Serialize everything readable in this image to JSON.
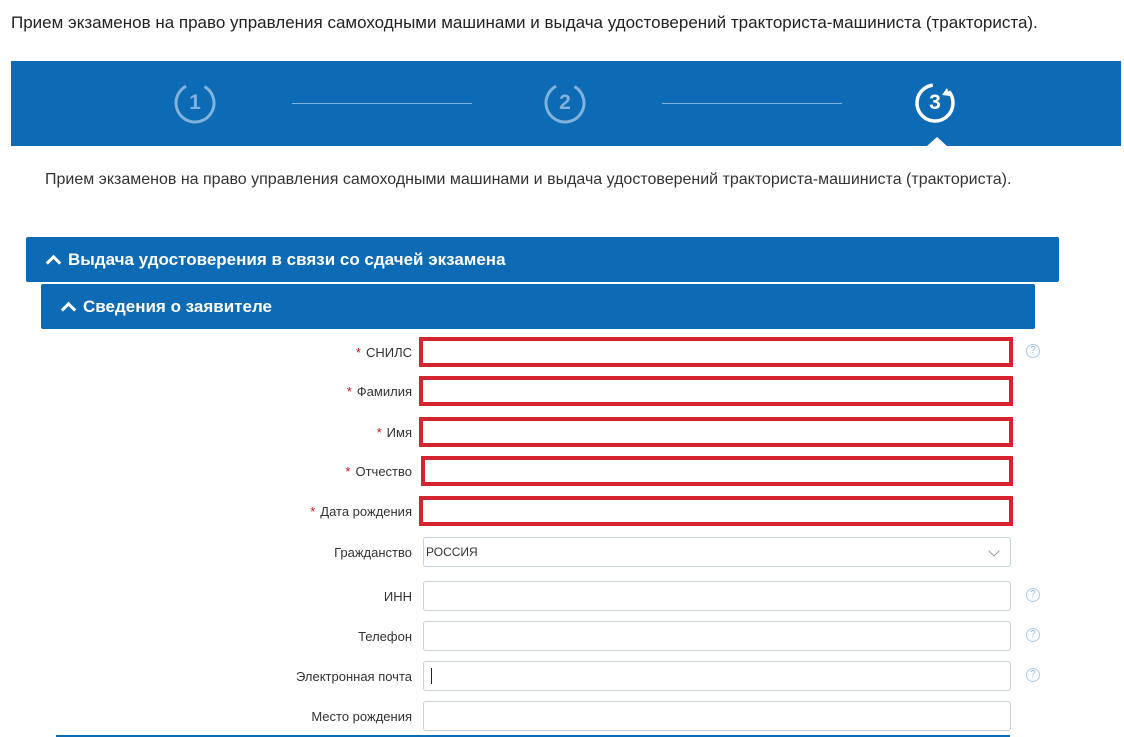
{
  "page": {
    "title": "Прием экзаменов на право управления самоходными машинами и выдача удостоверений тракториста-машиниста (тракториста)."
  },
  "stepper": {
    "steps": [
      {
        "number": "1",
        "state": "done"
      },
      {
        "number": "2",
        "state": "done"
      },
      {
        "number": "3",
        "state": "active"
      }
    ],
    "accent": "#0d6ab4"
  },
  "service": {
    "description": "Прием экзаменов на право управления самоходными машинами и выдача удостоверений тракториста-машиниста (тракториста)."
  },
  "sections": {
    "outer_label": "Выдача удостоверения в связи со сдачей экзамена",
    "inner_label": "Сведения о заявителе"
  },
  "form": {
    "required_mark": "*",
    "help_symbol": "?",
    "fields": {
      "snils": {
        "label": "СНИЛС",
        "value": ""
      },
      "surname": {
        "label": "Фамилия",
        "value": ""
      },
      "name": {
        "label": "Имя",
        "value": ""
      },
      "patronymic": {
        "label": "Отчество",
        "value": ""
      },
      "birth_date": {
        "label": "Дата рождения",
        "value": ""
      },
      "citizenship": {
        "label": "Гражданство",
        "value": "РОССИЯ"
      },
      "inn": {
        "label": "ИНН",
        "value": ""
      },
      "phone": {
        "label": "Телефон",
        "value": ""
      },
      "email": {
        "label": "Электронная почта",
        "value": ""
      },
      "birth_place": {
        "label": "Место рождения",
        "value": ""
      }
    }
  },
  "colors": {
    "primary": "#0d6ab4",
    "error_border": "#d62330",
    "required": "#d0121b"
  }
}
